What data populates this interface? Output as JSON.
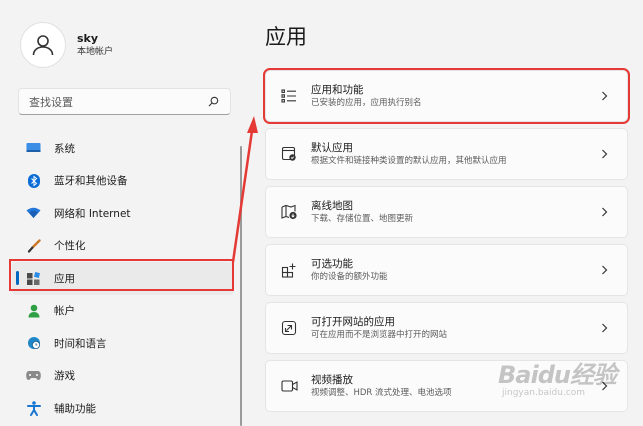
{
  "profile": {
    "name": "sky",
    "account_type": "本地帐户"
  },
  "search": {
    "placeholder": "查找设置"
  },
  "sidebar": {
    "items": [
      {
        "label": "系统",
        "icon": "monitor-icon",
        "active": false
      },
      {
        "label": "蓝牙和其他设备",
        "icon": "bluetooth-icon",
        "active": false
      },
      {
        "label": "网络和 Internet",
        "icon": "wifi-icon",
        "active": false
      },
      {
        "label": "个性化",
        "icon": "brush-icon",
        "active": false
      },
      {
        "label": "应用",
        "icon": "apps-icon",
        "active": true
      },
      {
        "label": "帐户",
        "icon": "person-icon",
        "active": false
      },
      {
        "label": "时间和语言",
        "icon": "globe-clock-icon",
        "active": false
      },
      {
        "label": "游戏",
        "icon": "gamepad-icon",
        "active": false
      },
      {
        "label": "辅助功能",
        "icon": "accessibility-icon",
        "active": false
      }
    ]
  },
  "main": {
    "title": "应用",
    "cards": [
      {
        "title": "应用和功能",
        "subtitle": "已安装的应用，应用执行别名",
        "icon": "list-icon",
        "highlighted": true
      },
      {
        "title": "默认应用",
        "subtitle": "根据文件和链接种类设置的默认应用，其他默认应用",
        "icon": "default-app-icon",
        "highlighted": false
      },
      {
        "title": "离线地图",
        "subtitle": "下载、存储位置、地图更新",
        "icon": "map-download-icon",
        "highlighted": false
      },
      {
        "title": "可选功能",
        "subtitle": "你的设备的额外功能",
        "icon": "optional-features-icon",
        "highlighted": false
      },
      {
        "title": "可打开网站的应用",
        "subtitle": "可在应用而不是浏览器中打开的网站",
        "icon": "open-link-icon",
        "highlighted": false
      },
      {
        "title": "视频播放",
        "subtitle": "视频调整、HDR 流式处理、电池选项",
        "icon": "video-icon",
        "highlighted": false
      }
    ]
  },
  "watermark": {
    "main": "Baidu经验",
    "sub": "jingyan.baidu.com"
  },
  "colors": {
    "accent": "#0067c0",
    "annotation": "#e53935"
  }
}
